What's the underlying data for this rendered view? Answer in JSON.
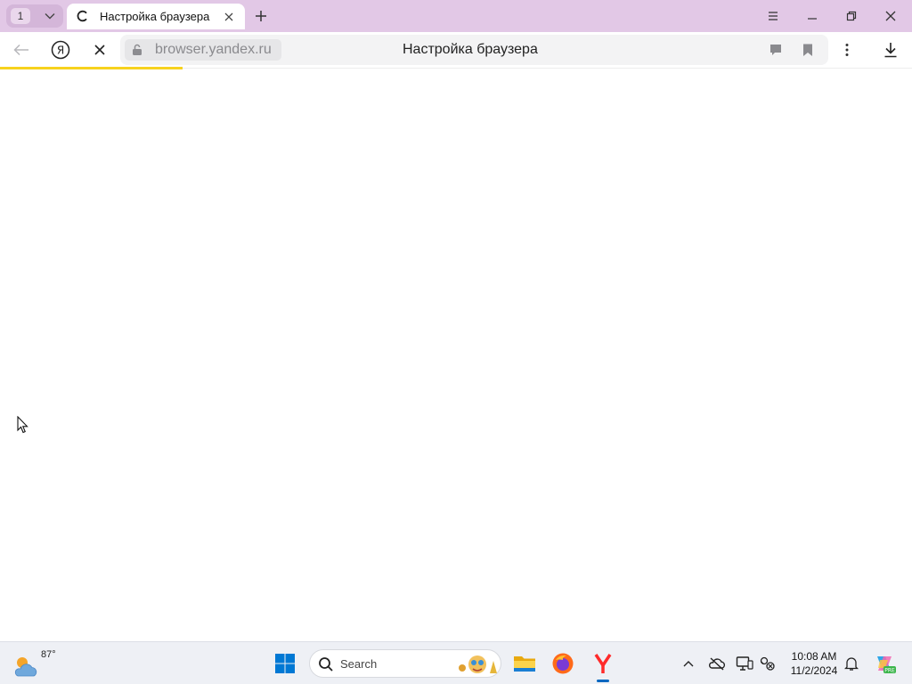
{
  "window": {
    "tab_count": "1",
    "tab_title": "Настройка браузера",
    "buttons": {
      "menu": "menu-icon",
      "minimize": "minimize-icon",
      "restore": "restore-icon",
      "close": "close-icon"
    }
  },
  "toolbar": {
    "domain": "browser.yandex.ru",
    "page_title": "Настройка браузера",
    "loading": true,
    "load_progress": 0.2
  },
  "taskbar": {
    "weather_temp": "87°",
    "search_placeholder": "Search",
    "apps": [
      "windows-start",
      "file-explorer",
      "firefox",
      "yandex-browser"
    ],
    "active_app": "yandex-browser",
    "clock_time": "10:08 AM",
    "clock_date": "11/2/2024"
  },
  "colors": {
    "tabstrip": "#e2c8e6",
    "progress": "#f7d21e",
    "yandex_red": "#ff2a2a",
    "windows_blue": "#0078d4"
  }
}
